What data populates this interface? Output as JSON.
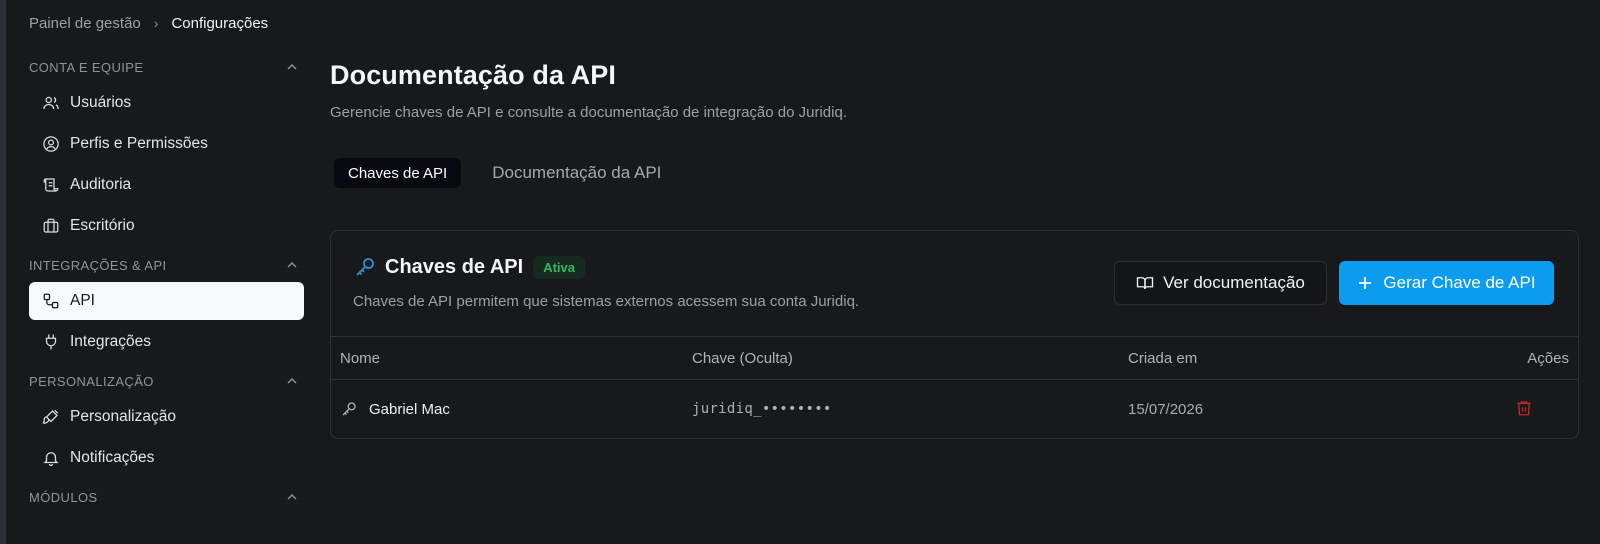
{
  "breadcrumb": {
    "parent": "Painel de gestão",
    "current": "Configurações"
  },
  "sidebar": {
    "sections": [
      {
        "title": "CONTA E EQUIPE",
        "items": [
          {
            "label": "Usuários",
            "icon": "users-icon"
          },
          {
            "label": "Perfis e Permissões",
            "icon": "user-circle-icon"
          },
          {
            "label": "Auditoria",
            "icon": "scroll-icon"
          },
          {
            "label": "Escritório",
            "icon": "briefcase-icon"
          }
        ]
      },
      {
        "title": "INTEGRAÇÕES & API",
        "items": [
          {
            "label": "API",
            "icon": "workflow-icon",
            "active": true
          },
          {
            "label": "Integrações",
            "icon": "plug-icon"
          }
        ]
      },
      {
        "title": "PERSONALIZAÇÃO",
        "items": [
          {
            "label": "Personalização",
            "icon": "paintbrush-icon"
          },
          {
            "label": "Notificações",
            "icon": "bell-icon"
          }
        ]
      },
      {
        "title": "MÓDULOS",
        "items": []
      }
    ]
  },
  "main": {
    "title": "Documentação da API",
    "subtitle": "Gerencie chaves de API e consulte a documentação de integração do Juridiq.",
    "tabs": [
      {
        "label": "Chaves de API",
        "active": true
      },
      {
        "label": "Documentação da API",
        "active": false
      }
    ]
  },
  "card": {
    "title": "Chaves de API",
    "badge": "Ativa",
    "description": "Chaves de API permitem que sistemas externos acessem sua conta Juridiq.",
    "doc_button": "Ver documentação",
    "generate_button": "Gerar Chave de API",
    "columns": {
      "name": "Nome",
      "key": "Chave (Oculta)",
      "created": "Criada em",
      "actions": "Ações"
    },
    "rows": [
      {
        "name": "Gabriel Mac",
        "key": "juridiq_••••••••",
        "created": "15/07/2026"
      }
    ]
  },
  "colors": {
    "accent": "#0b9cf0",
    "badge_text": "#33b867",
    "delete": "#c62828",
    "key_icon": "#2f8ed8"
  }
}
